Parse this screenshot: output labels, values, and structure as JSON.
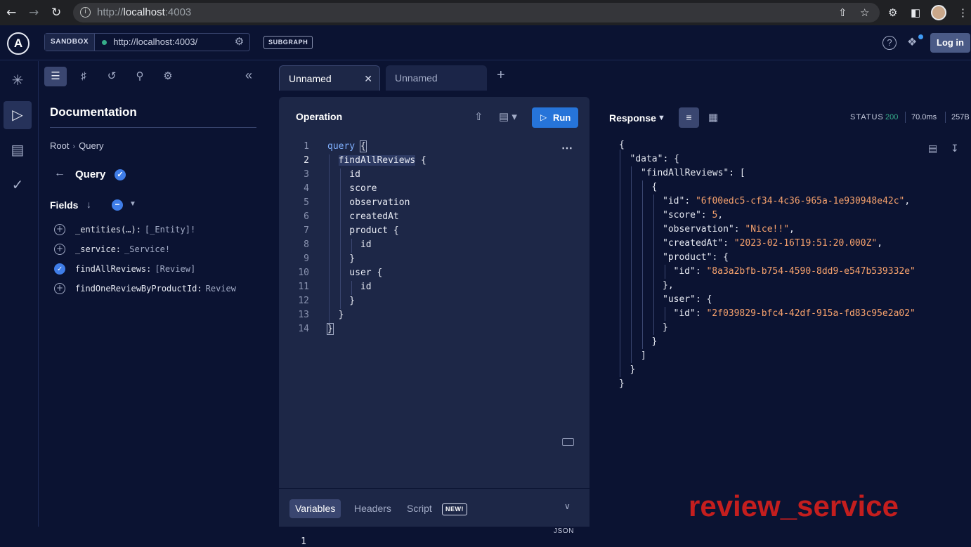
{
  "browser": {
    "url_prefix": "http://",
    "url_host": "localhost",
    "url_port": ":4003"
  },
  "topbar": {
    "sandbox_label": "SANDBOX",
    "endpoint": "http://localhost:4003/",
    "subgraph_label": "SUBGRAPH",
    "login_label": "Log in"
  },
  "docs": {
    "title": "Documentation",
    "breadcrumb": [
      "Root",
      "Query"
    ],
    "current": "Query",
    "fields_title": "Fields",
    "fields": [
      {
        "name": "_entities(…):",
        "type": "[_Entity]!",
        "selected": false
      },
      {
        "name": "_service:",
        "type": "_Service!",
        "selected": false
      },
      {
        "name": "findAllReviews:",
        "type": "[Review]",
        "selected": true
      },
      {
        "name": "findOneReviewByProductId:",
        "type": "Review",
        "selected": false
      }
    ]
  },
  "tabs": [
    {
      "label": "Unnamed",
      "active": true
    },
    {
      "label": "Unnamed",
      "active": false
    }
  ],
  "operation": {
    "title": "Operation",
    "run_label": "Run",
    "lines": [
      "query {",
      "  findAllReviews {",
      "    id",
      "    score",
      "    observation",
      "    createdAt",
      "    product {",
      "      id",
      "    }",
      "    user {",
      "      id",
      "    }",
      "  }",
      "}"
    ],
    "variables_tabs": [
      "Variables",
      "Headers",
      "Script"
    ],
    "new_badge": "NEW!",
    "json_label": "JSON",
    "variables_line": "1"
  },
  "response": {
    "title": "Response",
    "status_label": "STATUS",
    "status_code": "200",
    "timing": "70.0ms",
    "size": "257B",
    "lines": [
      {
        "indent": 0,
        "text": "{"
      },
      {
        "indent": 1,
        "key": "\"data\"",
        "rest": ": {"
      },
      {
        "indent": 2,
        "key": "\"findAllReviews\"",
        "rest": ": ["
      },
      {
        "indent": 3,
        "text": "{"
      },
      {
        "indent": 4,
        "key": "\"id\"",
        "val": "\"6f00edc5-cf34-4c36-965a-1e930948e42c\"",
        "rest": ","
      },
      {
        "indent": 4,
        "key": "\"score\"",
        "val": "5",
        "rest": ","
      },
      {
        "indent": 4,
        "key": "\"observation\"",
        "val": "\"Nice!!\"",
        "rest": ","
      },
      {
        "indent": 4,
        "key": "\"createdAt\"",
        "val": "\"2023-02-16T19:51:20.000Z\"",
        "rest": ","
      },
      {
        "indent": 4,
        "key": "\"product\"",
        "rest": ": {"
      },
      {
        "indent": 5,
        "key": "\"id\"",
        "val": "\"8a3a2bfb-b754-4590-8dd9-e547b539332e\""
      },
      {
        "indent": 4,
        "text": "},"
      },
      {
        "indent": 4,
        "key": "\"user\"",
        "rest": ": {"
      },
      {
        "indent": 5,
        "key": "\"id\"",
        "val": "\"2f039829-bfc4-42df-915a-fd83c95e2a02\""
      },
      {
        "indent": 4,
        "text": "}"
      },
      {
        "indent": 3,
        "text": "}"
      },
      {
        "indent": 2,
        "text": "]"
      },
      {
        "indent": 1,
        "text": "}"
      },
      {
        "indent": 0,
        "text": "}"
      }
    ]
  },
  "overlay_label": "review_service"
}
